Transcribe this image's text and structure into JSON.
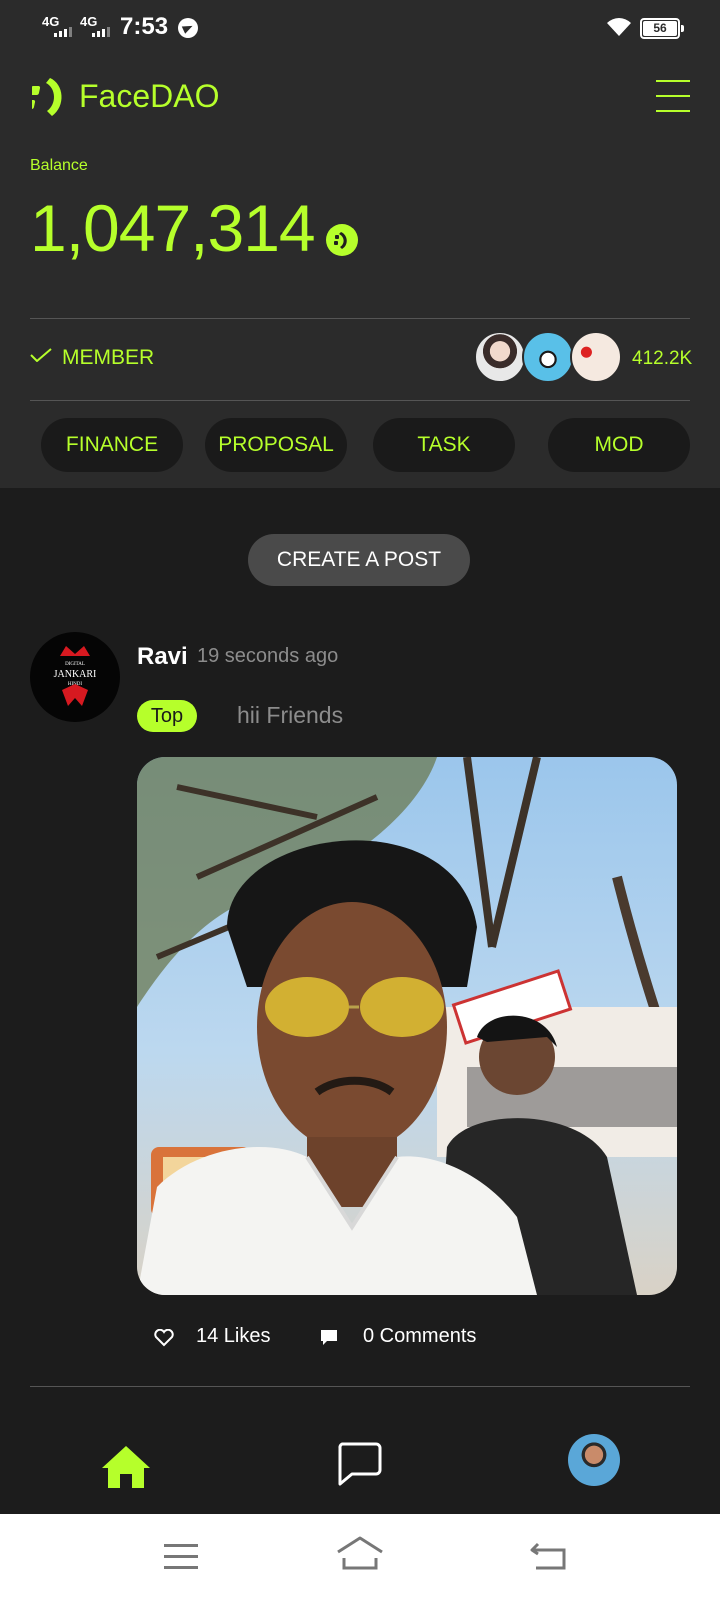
{
  "status_bar": {
    "network_1": "4G",
    "network_2": "4G",
    "time": "7:53",
    "battery": "56",
    "icons": [
      "signal-icon",
      "telegram-icon",
      "wifi-icon",
      "battery-icon"
    ]
  },
  "header": {
    "app_name": "FaceDAO",
    "logo_icon": "facedao-logo-icon",
    "menu_icon": "hamburger-menu-icon"
  },
  "balance": {
    "label": "Balance",
    "value": "1,047,314",
    "coin_symbol": "š"
  },
  "membership": {
    "status": "MEMBER",
    "member_count": "412.2K"
  },
  "nav_buttons": [
    "FINANCE",
    "PROPOSAL",
    "TASK",
    "MOD"
  ],
  "feed": {
    "create_post_label": "CREATE A POST",
    "posts": [
      {
        "author": "Ravi",
        "time": "19 seconds ago",
        "badge": "Top",
        "text": "hii Friends",
        "avatar_text": [
          "DIGITAL",
          "JANKARI",
          "HINDI"
        ],
        "likes": "14 Likes",
        "comments": "0 Comments"
      }
    ]
  },
  "bottom_nav": [
    "home-icon",
    "chat-icon",
    "profile-avatar"
  ],
  "colors": {
    "accent": "#b6ff2b",
    "header_bg": "#2b2b2b",
    "page_bg": "#1c1c1c",
    "pill_bg": "#1a1a1a"
  }
}
